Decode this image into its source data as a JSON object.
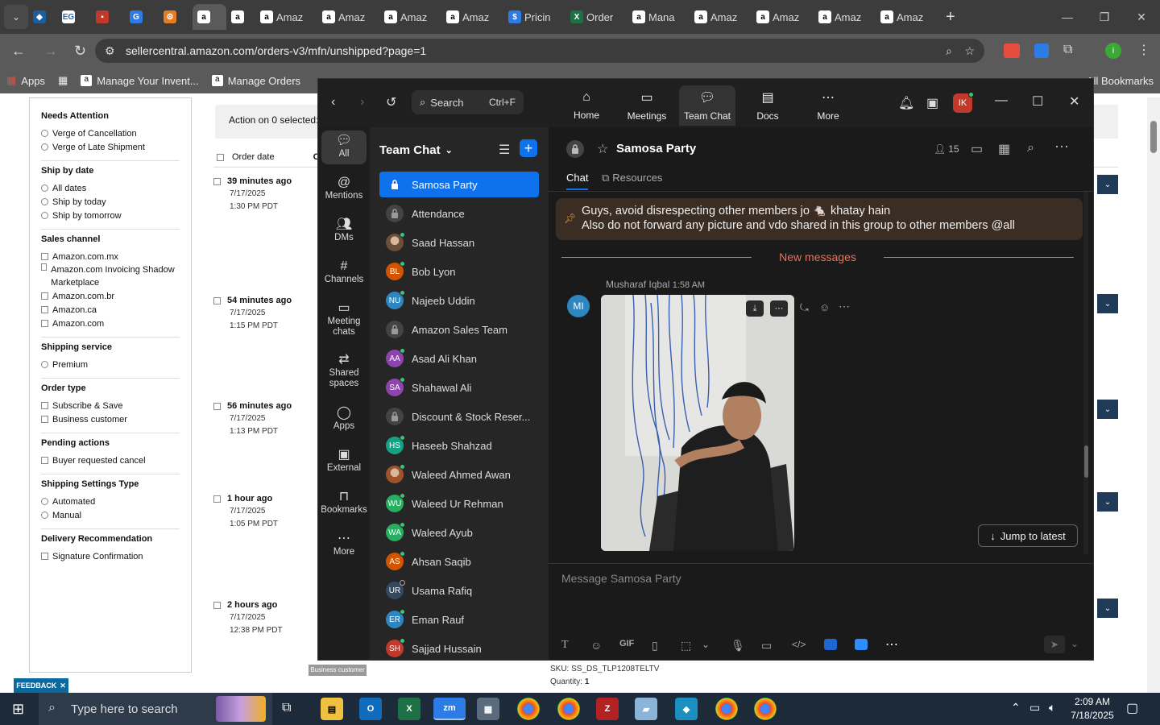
{
  "browser": {
    "tabs": [
      "Amaz",
      "Amaz",
      "Amaz",
      "Amaz",
      "Pricin",
      "Order",
      "Mana",
      "Amaz",
      "Amaz",
      "Amaz",
      "Amaz"
    ],
    "url": "sellercentral.amazon.com/orders-v3/mfn/unshipped?page=1",
    "bookmarks": [
      "Apps",
      "Manage Your Invent...",
      "Manage Orders"
    ],
    "all_bookmarks": "All Bookmarks"
  },
  "amazon": {
    "filters": [
      {
        "title": "Needs Attention",
        "type": "radio",
        "options": [
          "Verge of Cancellation",
          "Verge of Late Shipment"
        ]
      },
      {
        "title": "Ship by date",
        "type": "radio",
        "options": [
          "All dates",
          "Ship by today",
          "Ship by tomorrow"
        ]
      },
      {
        "title": "Sales channel",
        "type": "check",
        "options": [
          "Amazon.com.mx",
          "Amazon.com Invoicing Shadow Marketplace",
          "Amazon.com.br",
          "Amazon.ca",
          "Amazon.com"
        ]
      },
      {
        "title": "Shipping service",
        "type": "radio",
        "options": [
          "Premium"
        ]
      },
      {
        "title": "Order type",
        "type": "check",
        "options": [
          "Subscribe & Save",
          "Business customer"
        ]
      },
      {
        "title": "Pending actions",
        "type": "check",
        "options": [
          "Buyer requested cancel"
        ]
      },
      {
        "title": "Shipping Settings Type",
        "type": "radio",
        "options": [
          "Automated",
          "Manual"
        ]
      },
      {
        "title": "Delivery Recommendation",
        "type": "check",
        "options": [
          "Signature Confirmation"
        ]
      }
    ],
    "action_text": "Action on 0 selected:",
    "col_order_date": "Order date",
    "col_order": "Or",
    "orders": [
      {
        "ago": "39 minutes ago",
        "date": "7/17/2025",
        "time": "1:30 PM PDT"
      },
      {
        "ago": "54 minutes ago",
        "date": "7/17/2025",
        "time": "1:15 PM PDT"
      },
      {
        "ago": "56 minutes ago",
        "date": "7/17/2025",
        "time": "1:13 PM PDT"
      },
      {
        "ago": "1 hour ago",
        "date": "7/17/2025",
        "time": "1:05 PM PDT"
      },
      {
        "ago": "2 hours ago",
        "date": "7/17/2025",
        "time": "12:38 PM PDT"
      }
    ],
    "business_badge": "Business customer",
    "sku": "SKU: SS_DS_TLP1208TELTV",
    "quantity_label": "Quantity:",
    "quantity": "1",
    "feedback": "FEEDBACK"
  },
  "zoom": {
    "search_label": "Search",
    "search_shortcut": "Ctrl+F",
    "nav": [
      "Home",
      "Meetings",
      "Team Chat",
      "Docs",
      "More"
    ],
    "profile_initials": "IK",
    "rail": [
      "All",
      "Mentions",
      "DMs",
      "Channels",
      "Meeting chats",
      "Shared spaces",
      "Apps",
      "External",
      "Bookmarks",
      "More"
    ],
    "list_title": "Team Chat",
    "channels": [
      {
        "name": "Samosa Party",
        "kind": "lock",
        "selected": true
      },
      {
        "name": "Attendance",
        "kind": "lock"
      },
      {
        "name": "Saad Hassan",
        "kind": "photo",
        "color": "#6b4f3a",
        "online": true
      },
      {
        "name": "Bob Lyon",
        "kind": "initials",
        "initials": "BL",
        "color": "#d35400",
        "online": true
      },
      {
        "name": "Najeeb Uddin",
        "kind": "initials",
        "initials": "NU",
        "color": "#2e86c1",
        "online": true
      },
      {
        "name": "Amazon Sales Team",
        "kind": "lock"
      },
      {
        "name": "Asad Ali Khan",
        "kind": "initials",
        "initials": "AA",
        "color": "#8e44ad",
        "online": true
      },
      {
        "name": "Shahawal Ali",
        "kind": "initials",
        "initials": "SA",
        "color": "#8e44ad",
        "online": true
      },
      {
        "name": "Discount & Stock Reser...",
        "kind": "lock"
      },
      {
        "name": "Haseeb Shahzad",
        "kind": "initials",
        "initials": "HS",
        "color": "#16a085",
        "online": true
      },
      {
        "name": "Waleed Ahmed Awan",
        "kind": "photo",
        "color": "#a0522d",
        "online": true
      },
      {
        "name": "Waleed Ur Rehman",
        "kind": "initials",
        "initials": "WU",
        "color": "#27ae60",
        "online": true
      },
      {
        "name": "Waleed Ayub",
        "kind": "initials",
        "initials": "WA",
        "color": "#27ae60",
        "online": true
      },
      {
        "name": "Ahsan Saqib",
        "kind": "initials",
        "initials": "AS",
        "color": "#d35400",
        "online": true
      },
      {
        "name": "Usama Rafiq",
        "kind": "initials",
        "initials": "UR",
        "color": "#34495e",
        "online": false
      },
      {
        "name": "Eman Rauf",
        "kind": "initials",
        "initials": "ER",
        "color": "#2e86c1",
        "online": true
      },
      {
        "name": "Sajjad Hussain",
        "kind": "initials",
        "initials": "SH",
        "color": "#c0392b",
        "online": true
      }
    ],
    "chat_title": "Samosa Party",
    "member_count": "15",
    "tabs": [
      "Chat",
      "Resources"
    ],
    "pinned_line1": "Guys, avoid disrespecting other members jo 🐁 khatay hain",
    "pinned_line2": "Also do not forward any picture and vdo shared in this group to other members @all",
    "new_messages": "New messages",
    "msg_avatar": "MI",
    "msg_author": "Musharaf Iqbal",
    "msg_time": "1:58 AM",
    "jump_latest": "Jump to latest",
    "composer_placeholder": "Message Samosa Party",
    "gif_label": "GIF"
  },
  "taskbar": {
    "search_placeholder": "Type here to search",
    "time": "2:09 AM",
    "date": "7/18/2025"
  }
}
